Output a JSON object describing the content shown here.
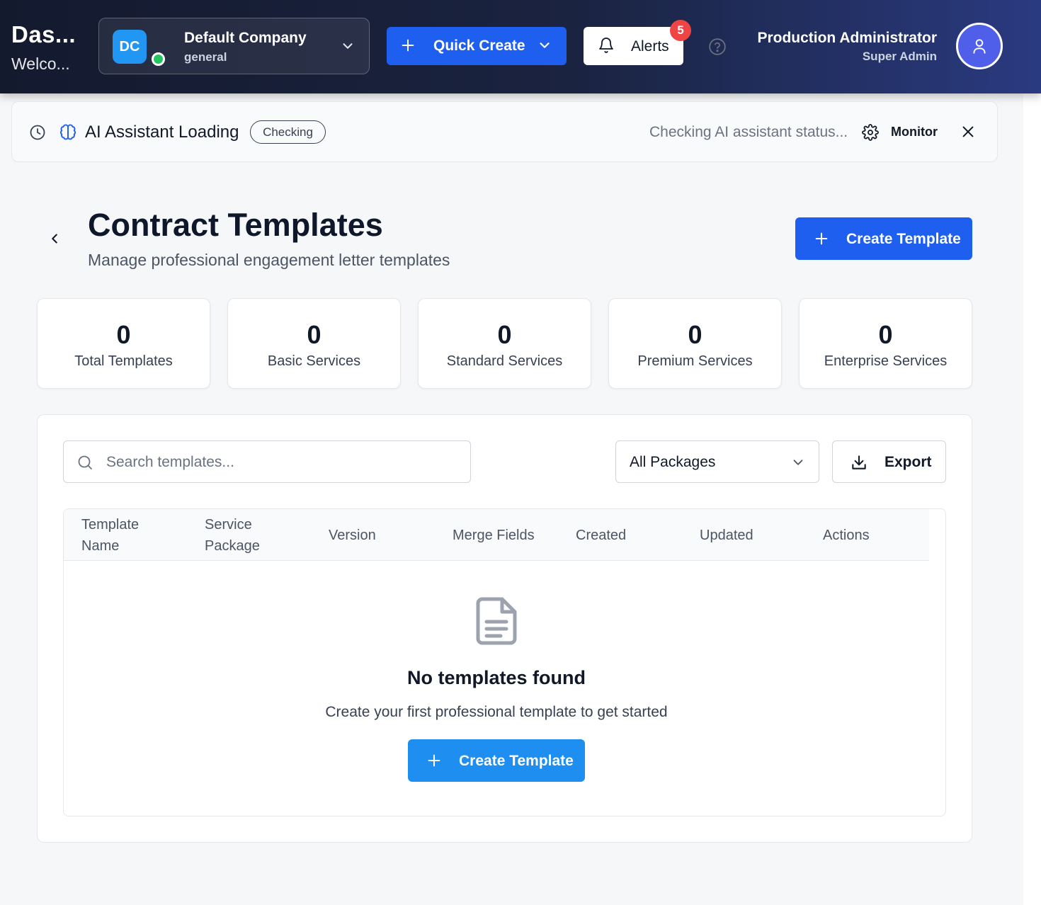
{
  "header": {
    "title": "Das...",
    "subtitle": "Welco...",
    "company": {
      "initials": "DC",
      "name": "Default Company",
      "type": "general"
    },
    "quick_create_label": "Quick Create",
    "alerts_label": "Alerts",
    "alerts_count": "5",
    "user": {
      "name": "Production Administrator",
      "role": "Super Admin"
    }
  },
  "ai_status": {
    "title": "AI Assistant Loading",
    "pill": "Checking",
    "message": "Checking AI assistant status...",
    "monitor_label": "Monitor"
  },
  "page": {
    "title": "Contract Templates",
    "subtitle": "Manage professional engagement letter templates",
    "create_label": "Create Template"
  },
  "stats": [
    {
      "value": "0",
      "label": "Total Templates"
    },
    {
      "value": "0",
      "label": "Basic Services"
    },
    {
      "value": "0",
      "label": "Standard Services"
    },
    {
      "value": "0",
      "label": "Premium Services"
    },
    {
      "value": "0",
      "label": "Enterprise Services"
    }
  ],
  "toolbar": {
    "search_placeholder": "Search templates...",
    "package_filter": "All Packages",
    "export_label": "Export"
  },
  "table": {
    "columns": [
      {
        "line1": "Template",
        "line2": "Name"
      },
      {
        "line1": "Service",
        "line2": "Package"
      },
      {
        "line1": "Version"
      },
      {
        "line1": "Merge Fields"
      },
      {
        "line1": "Created"
      },
      {
        "line1": "Updated"
      },
      {
        "line1": "Actions"
      }
    ]
  },
  "empty_state": {
    "title": "No templates found",
    "message": "Create your first professional template to get started",
    "button_label": "Create Template"
  },
  "colors": {
    "primary": "#1f5ff0",
    "empty_button": "#1e8ff0",
    "badge": "#ef4444",
    "online": "#22c55e"
  }
}
